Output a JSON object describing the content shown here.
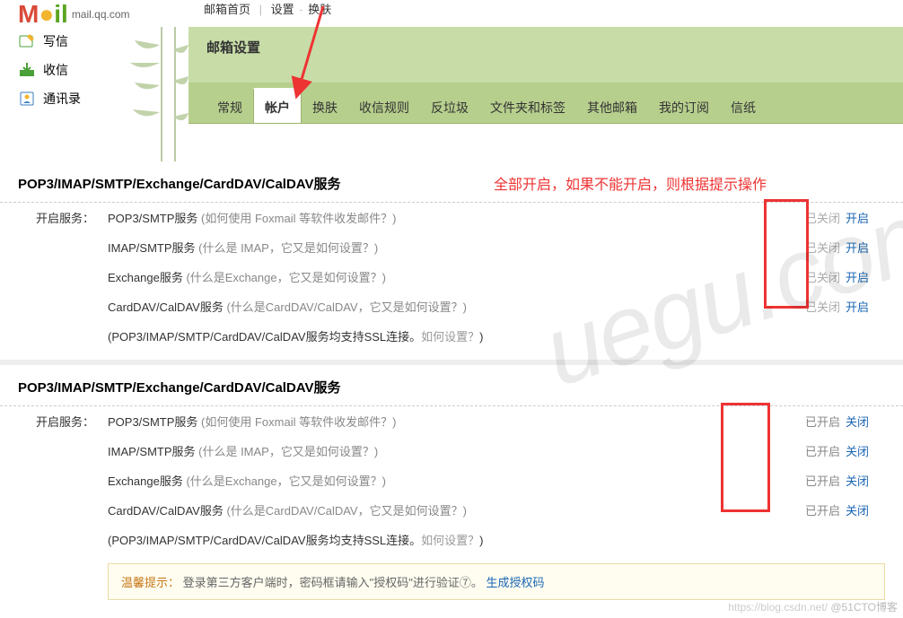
{
  "brand": {
    "sub": "mail.qq.com"
  },
  "topnav": {
    "home": "邮箱首页",
    "settings": "设置",
    "skin": "换肤",
    "sep": "|",
    "dash": " - "
  },
  "sidebar": {
    "compose": "写信",
    "inbox": "收信",
    "contacts": "通讯录"
  },
  "titlebar": {
    "title": "邮箱设置"
  },
  "tabs": [
    "常规",
    "帐户",
    "换肤",
    "收信规则",
    "反垃圾",
    "文件夹和标签",
    "其他邮箱",
    "我的订阅",
    "信纸"
  ],
  "active_tab_index": 1,
  "section_title": "POP3/IMAP/SMTP/Exchange/CardDAV/CalDAV服务",
  "labels": {
    "enable_service": "开启服务：",
    "closed": "已关闭",
    "opened": "已开启",
    "open_action": "开启",
    "close_action": "关闭"
  },
  "services": [
    {
      "name": "POP3/SMTP服务",
      "q": "(如何使用 Foxmail 等软件收发邮件？)"
    },
    {
      "name": "IMAP/SMTP服务",
      "q": "(什么是 IMAP，它又是如何设置？)"
    },
    {
      "name": "Exchange服务",
      "q": "(什么是Exchange，它又是如何设置？)"
    },
    {
      "name": "CardDAV/CalDAV服务",
      "q": "(什么是CardDAV/CalDAV，它又是如何设置？)"
    }
  ],
  "ssl_hint": "(POP3/IMAP/SMTP/CardDAV/CalDAV服务均支持SSL连接。",
  "ssl_hint_link": "如何设置？",
  "ssl_hint_end": ")",
  "annotation": "全部开启，如果不能开启，则根据提示操作",
  "warmtip": {
    "label": "温馨提示：",
    "text": "登录第三方客户端时，密码框请输入\"授权码\"进行验证⑦。",
    "gen": "生成授权码"
  },
  "footer": {
    "csdn": "https://blog.csdn.net/",
    "cto": "@51CTO博客"
  }
}
